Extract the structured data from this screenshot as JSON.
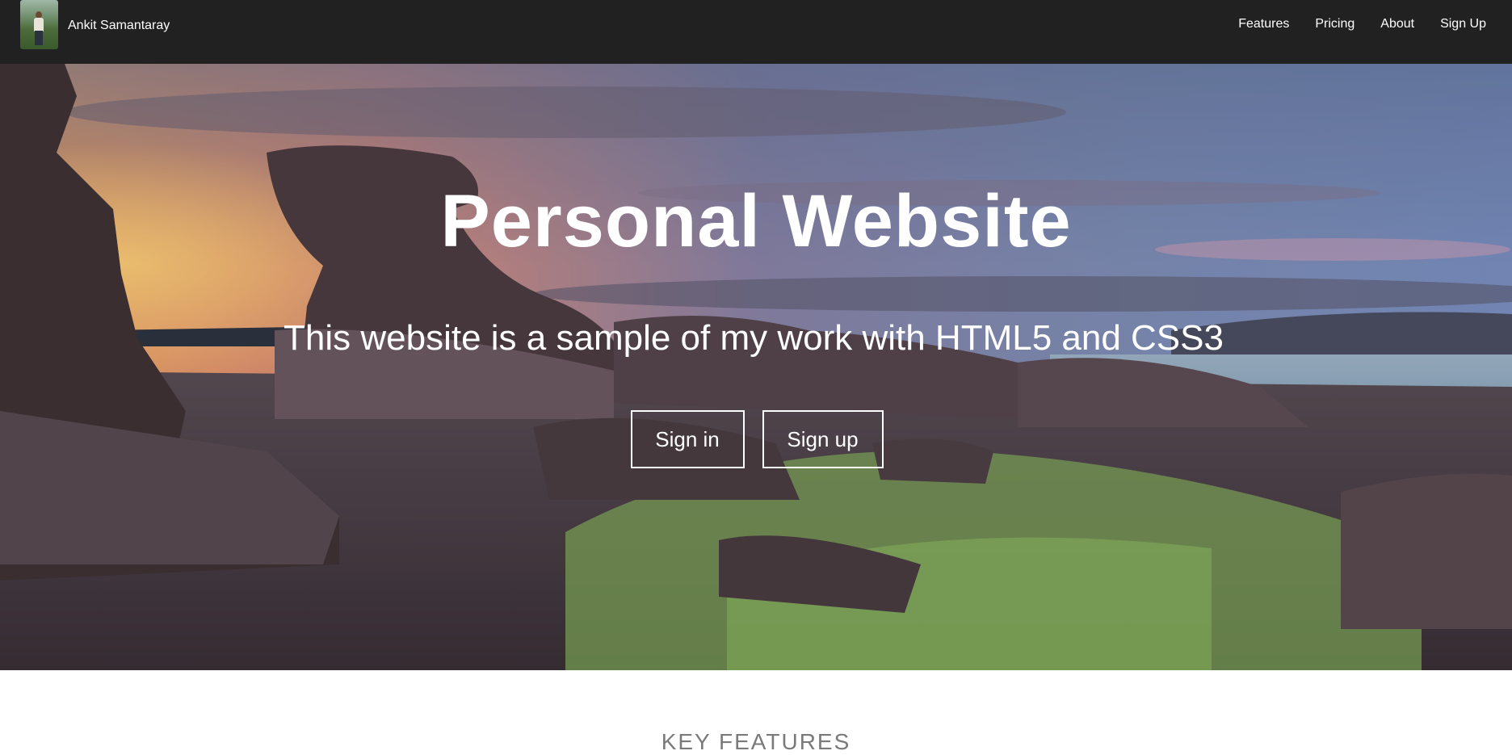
{
  "navbar": {
    "brand_name": "Ankit Samantaray",
    "avatar_icon": "profile-photo",
    "links": [
      {
        "label": "Features"
      },
      {
        "label": "Pricing"
      },
      {
        "label": "About"
      },
      {
        "label": "Sign Up"
      }
    ]
  },
  "hero": {
    "title": "Personal Website",
    "subtitle": "This website is a sample of my work with HTML5 and CSS3",
    "buttons": {
      "sign_in": "Sign in",
      "sign_up": "Sign up"
    },
    "background_image": "coastal-rocks-sunset-photo"
  },
  "features": {
    "heading": "KEY FEATURES"
  },
  "colors": {
    "navbar_bg": "#212121",
    "text_light": "#ffffff",
    "heading_gray": "#7a7a7a"
  }
}
